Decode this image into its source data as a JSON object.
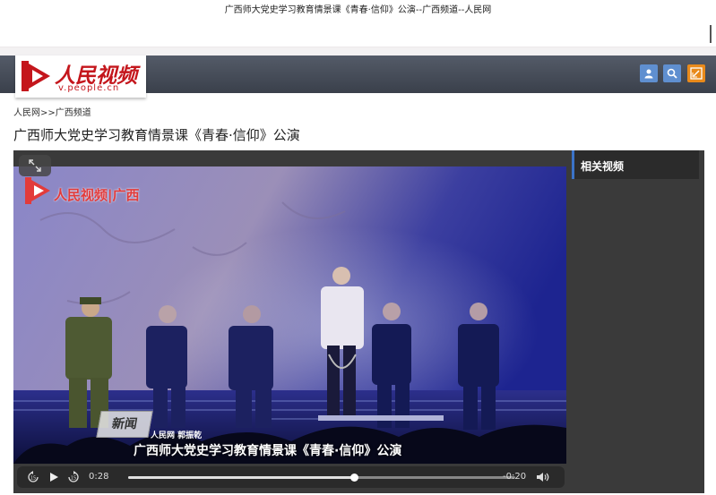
{
  "browser": {
    "title": "广西师大党史学习教育情景课《青春·信仰》公演--广西频道--人民网"
  },
  "header": {
    "logo_text": "人民视频",
    "logo_url": "v.people.cn",
    "buttons": [
      {
        "name": "user-icon"
      },
      {
        "name": "search-icon"
      },
      {
        "name": "edit-icon"
      }
    ]
  },
  "breadcrumb": {
    "home": "人民网",
    "sep": ">>",
    "section": "广西频道"
  },
  "article": {
    "title": "广西师大党史学习教育情景课《青春·信仰》公演"
  },
  "video": {
    "watermark_text": "人民视频|广西",
    "subtitle_credit": "人民网 郭振乾",
    "subtitle_main": "广西师大党史学习教育情景课《青春·信仰》公演",
    "news_badge": "新闻"
  },
  "player": {
    "current_time": "0:28",
    "remaining_time": "-0:20",
    "progress_fraction": 0.583
  },
  "sidebar": {
    "heading": "相关视频"
  },
  "colors": {
    "brand_red": "#c4161c",
    "header_bg": "#4a505c",
    "accent_blue": "#3b73c8"
  }
}
